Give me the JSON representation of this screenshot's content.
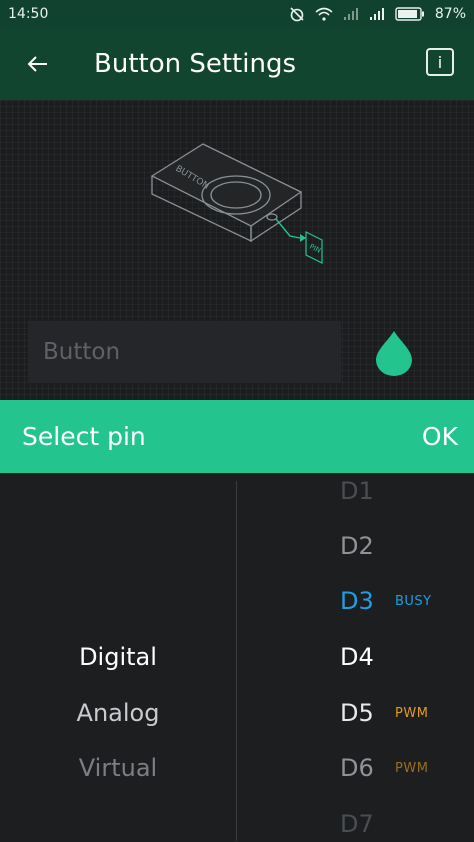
{
  "status_bar": {
    "time": "14:50",
    "battery": "87%",
    "icons": [
      "alarm-off-icon",
      "wifi-icon",
      "signal-icon",
      "signal-icon",
      "battery-icon"
    ]
  },
  "app_bar": {
    "title": "Button Settings",
    "back_icon": "arrow-left-icon",
    "info_label": "i"
  },
  "preview": {
    "device_label": "BUTTON",
    "pin_label": "PIN",
    "name_placeholder": "Button",
    "drop_color": "#23c48e"
  },
  "select_pin": {
    "title": "Select pin",
    "ok_label": "OK"
  },
  "picker": {
    "types": [
      {
        "label": "Digital",
        "state": "selected"
      },
      {
        "label": "Analog",
        "state": "near"
      },
      {
        "label": "Virtual",
        "state": "far"
      }
    ],
    "pins": [
      {
        "label": "D1",
        "tag": ""
      },
      {
        "label": "D2",
        "tag": ""
      },
      {
        "label": "D3",
        "tag": "BUSY"
      },
      {
        "label": "D4",
        "tag": ""
      },
      {
        "label": "D5",
        "tag": "PWM"
      },
      {
        "label": "D6",
        "tag": "PWM"
      },
      {
        "label": "D7",
        "tag": ""
      }
    ]
  },
  "colors": {
    "accent": "#23c48e",
    "header": "#11452f",
    "busy": "#1f9ee0",
    "pwm": "#e09a23"
  }
}
